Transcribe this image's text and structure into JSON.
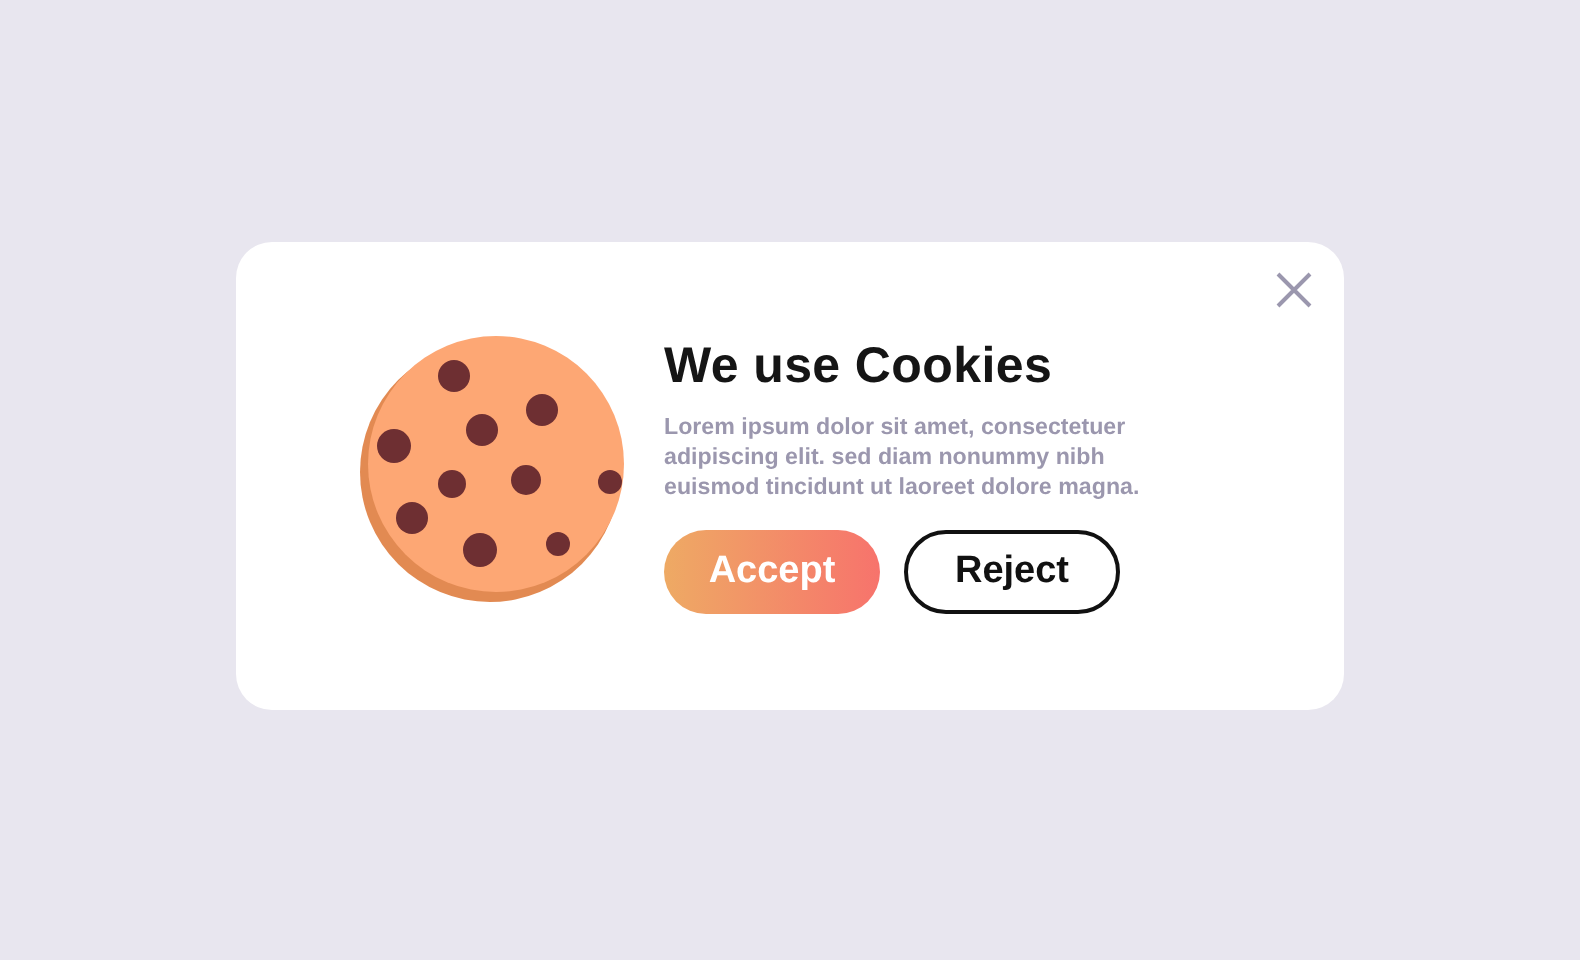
{
  "dialog": {
    "title": "We use Cookies",
    "message": "Lorem ipsum dolor sit amet, consectetuer adipiscing elit. sed diam nonummy nibh euismod tincidunt ut laoreet dolore magna.",
    "buttons": [
      {
        "label": "Accept",
        "kind": "primary"
      },
      {
        "label": "Reject",
        "kind": "outline"
      }
    ]
  }
}
